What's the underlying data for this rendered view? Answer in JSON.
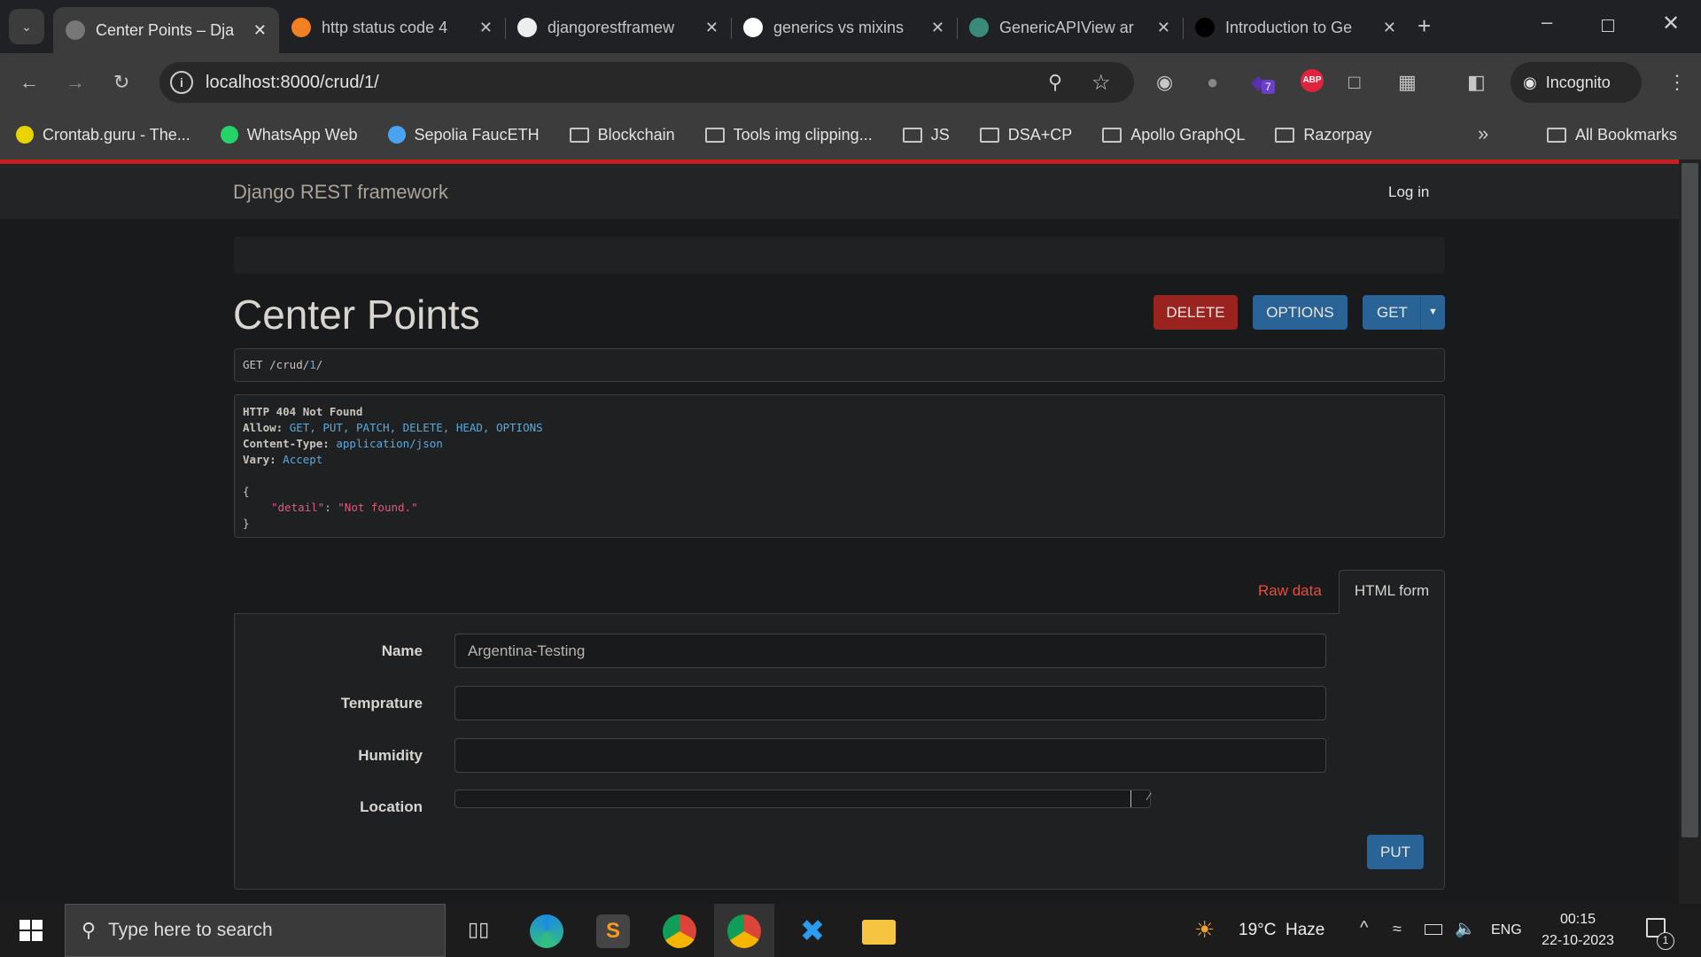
{
  "browser": {
    "tabs": [
      {
        "title": "Center Points – Dja",
        "icon": "globe-icon",
        "active": true
      },
      {
        "title": "http status code 4",
        "icon": "stackoverflow-icon"
      },
      {
        "title": "djangorestframew",
        "icon": "cube-icon"
      },
      {
        "title": "generics vs mixins",
        "icon": "google-icon"
      },
      {
        "title": "GenericAPIView ar",
        "icon": "site-icon"
      },
      {
        "title": "Introduction to Ge",
        "icon": "medium-icon"
      }
    ],
    "url": "localhost:8000/crud/1/",
    "profile_label": "Incognito",
    "extension_badge": "7",
    "abp_label": "ABP",
    "bookmarks": [
      "Crontab.guru - The...",
      "WhatsApp Web",
      "Sepolia FaucETH",
      "Blockchain",
      "Tools img clipping...",
      "JS",
      "DSA+CP",
      "Apollo GraphQL",
      "Razorpay"
    ],
    "all_bookmarks": "All Bookmarks"
  },
  "page": {
    "brand": "Django REST framework",
    "login": "Log in",
    "title": "Center Points",
    "buttons": {
      "delete": "DELETE",
      "options": "OPTIONS",
      "get": "GET",
      "put": "PUT"
    },
    "request_line": {
      "method": "GET",
      "path": "/crud/",
      "id": "1",
      "trail": "/"
    },
    "response": {
      "status": "HTTP 404 Not Found",
      "headers": [
        {
          "key": "Allow:",
          "value": "GET, PUT, PATCH, DELETE, HEAD, OPTIONS"
        },
        {
          "key": "Content-Type:",
          "value": "application/json"
        },
        {
          "key": "Vary:",
          "value": "Accept"
        }
      ],
      "open": "{",
      "body_key": "\"detail\"",
      "body_value": "\"Not found.\"",
      "close": "}"
    },
    "form_tabs": {
      "raw": "Raw data",
      "html": "HTML form"
    },
    "fields": [
      {
        "label": "Name",
        "value": "Argentina-Testing"
      },
      {
        "label": "Temprature",
        "value": ""
      },
      {
        "label": "Humidity",
        "value": ""
      },
      {
        "label": "Location",
        "value": ""
      }
    ],
    "colors": {
      "delete": "#9a2320",
      "primary": "#2a6496",
      "link": "#e74c3c",
      "accent_bar": "#c51f1f"
    }
  },
  "taskbar": {
    "search_placeholder": "Type here to search",
    "weather": "19°C  Haze",
    "lang": "ENG",
    "time": "00:15",
    "date": "22-10-2023",
    "notif": "1"
  }
}
